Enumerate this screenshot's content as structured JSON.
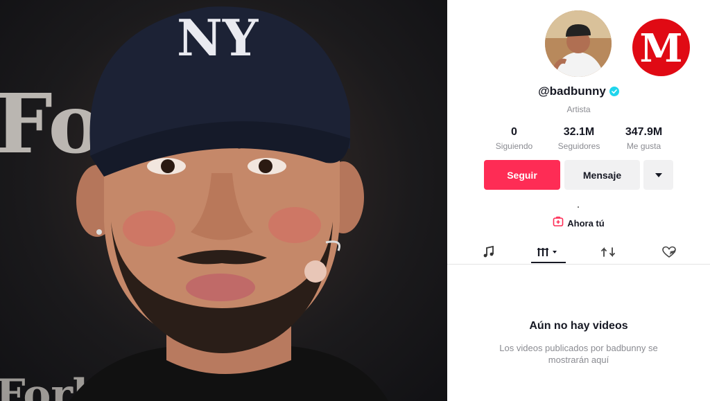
{
  "photo": {
    "backdrop_text": "Forbes",
    "cap_logo": "NY"
  },
  "profile": {
    "handle": "@badbunny",
    "bio": "Artista",
    "stats": [
      {
        "value": "0",
        "label": "Siguiendo"
      },
      {
        "value": "32.1M",
        "label": "Seguidores"
      },
      {
        "value": "347.9M",
        "label": "Me gusta"
      }
    ],
    "buttons": {
      "follow": "Seguir",
      "message": "Mensaje"
    },
    "now_label": "Ahora tú",
    "empty_title": "Aún no hay videos",
    "empty_description": "Los videos publicados por badbunny se mostrarán aquí"
  },
  "brand_logo": {
    "letter": "M",
    "color": "#e00a14"
  },
  "colors": {
    "accent": "#fe2c55",
    "verified": "#20d5ec"
  }
}
